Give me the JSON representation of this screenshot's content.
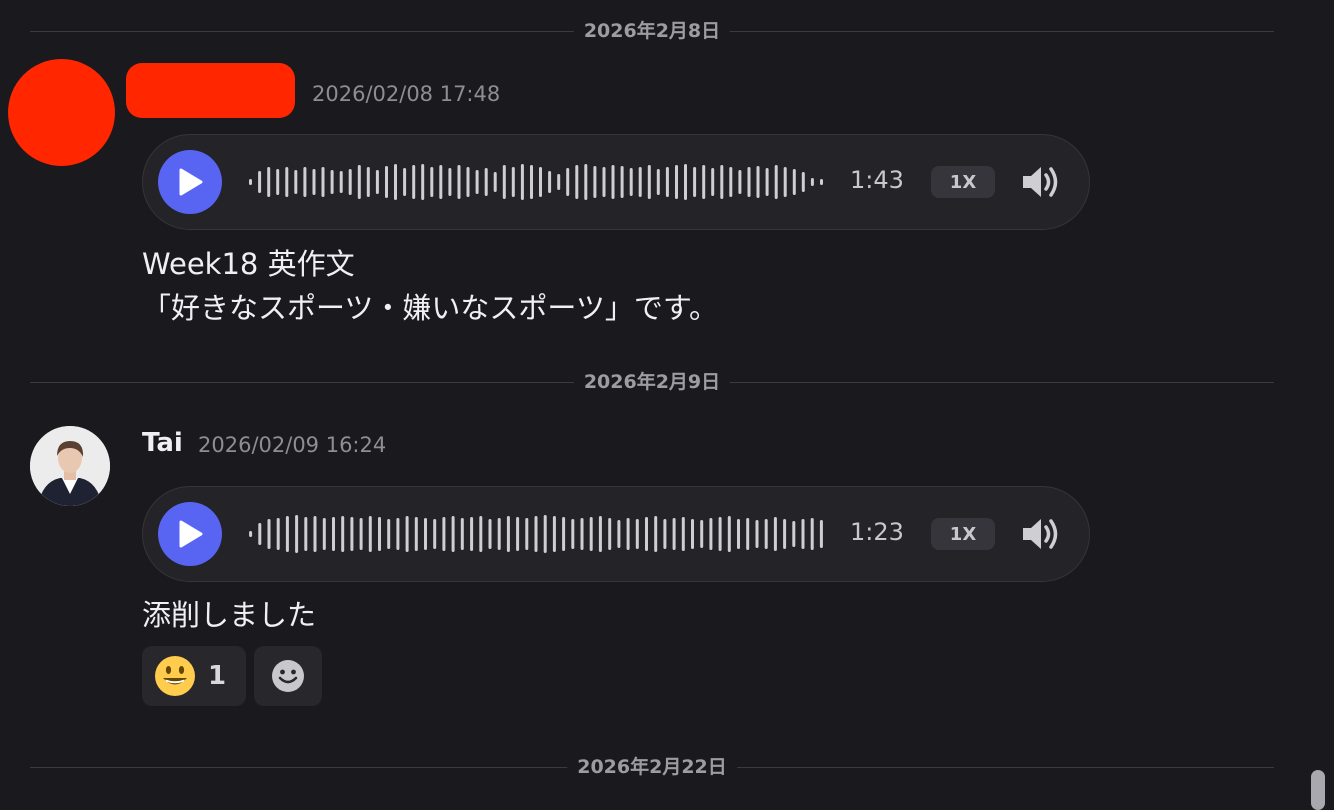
{
  "dividers": [
    {
      "label": "2026年2月8日"
    },
    {
      "label": "2026年2月9日"
    },
    {
      "label": "2026年2月22日"
    }
  ],
  "messages": [
    {
      "author": "",
      "timestamp": "2026/02/08 17:48",
      "voice": {
        "duration": "1:43",
        "speed": "1X",
        "play_icon": "play-icon",
        "volume_icon": "volume-icon"
      },
      "text_lines": [
        "Week18 英作文",
        "「好きなスポーツ・嫌いなスポーツ」です。"
      ]
    },
    {
      "author": "Tai",
      "timestamp": "2026/02/09 16:24",
      "voice": {
        "duration": "1:23",
        "speed": "1X",
        "play_icon": "play-icon",
        "volume_icon": "volume-icon"
      },
      "text_lines": [
        "添削しました"
      ],
      "reactions": [
        {
          "emoji": "😃",
          "count": "1"
        }
      ],
      "add_reaction_icon": "add-reaction-icon"
    }
  ],
  "colors": {
    "accent": "#5865f2",
    "redacted": "#ff2600",
    "background": "#1a1a1e"
  }
}
